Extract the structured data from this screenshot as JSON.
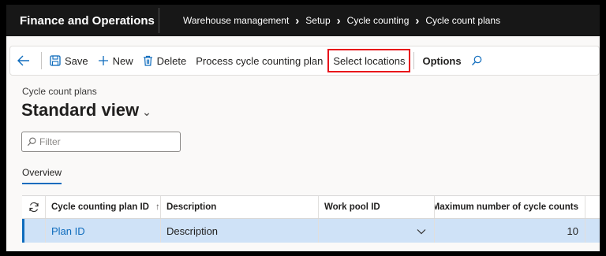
{
  "app": {
    "title": "Finance and Operations"
  },
  "breadcrumbs": [
    "Warehouse management",
    "Setup",
    "Cycle counting",
    "Cycle count plans"
  ],
  "actions": {
    "save": "Save",
    "new": "New",
    "delete": "Delete",
    "process": "Process cycle counting plan",
    "select_locations": "Select locations",
    "options": "Options"
  },
  "page": {
    "breadcrumb": "Cycle count plans",
    "view_title": "Standard view"
  },
  "filter": {
    "placeholder": "Filter"
  },
  "tabs": {
    "overview": "Overview"
  },
  "grid": {
    "columns": [
      "Cycle counting plan ID",
      "Description",
      "Work pool ID",
      "Maximum number of cycle counts"
    ],
    "rows": [
      {
        "plan_id": "Plan ID",
        "description": "Description",
        "work_pool_id": "",
        "max_counts": "10"
      }
    ]
  },
  "colors": {
    "accent": "#0f6cbd",
    "highlight": "#e8121a",
    "selected_row": "#cfe2f7",
    "topbar": "#171717"
  }
}
